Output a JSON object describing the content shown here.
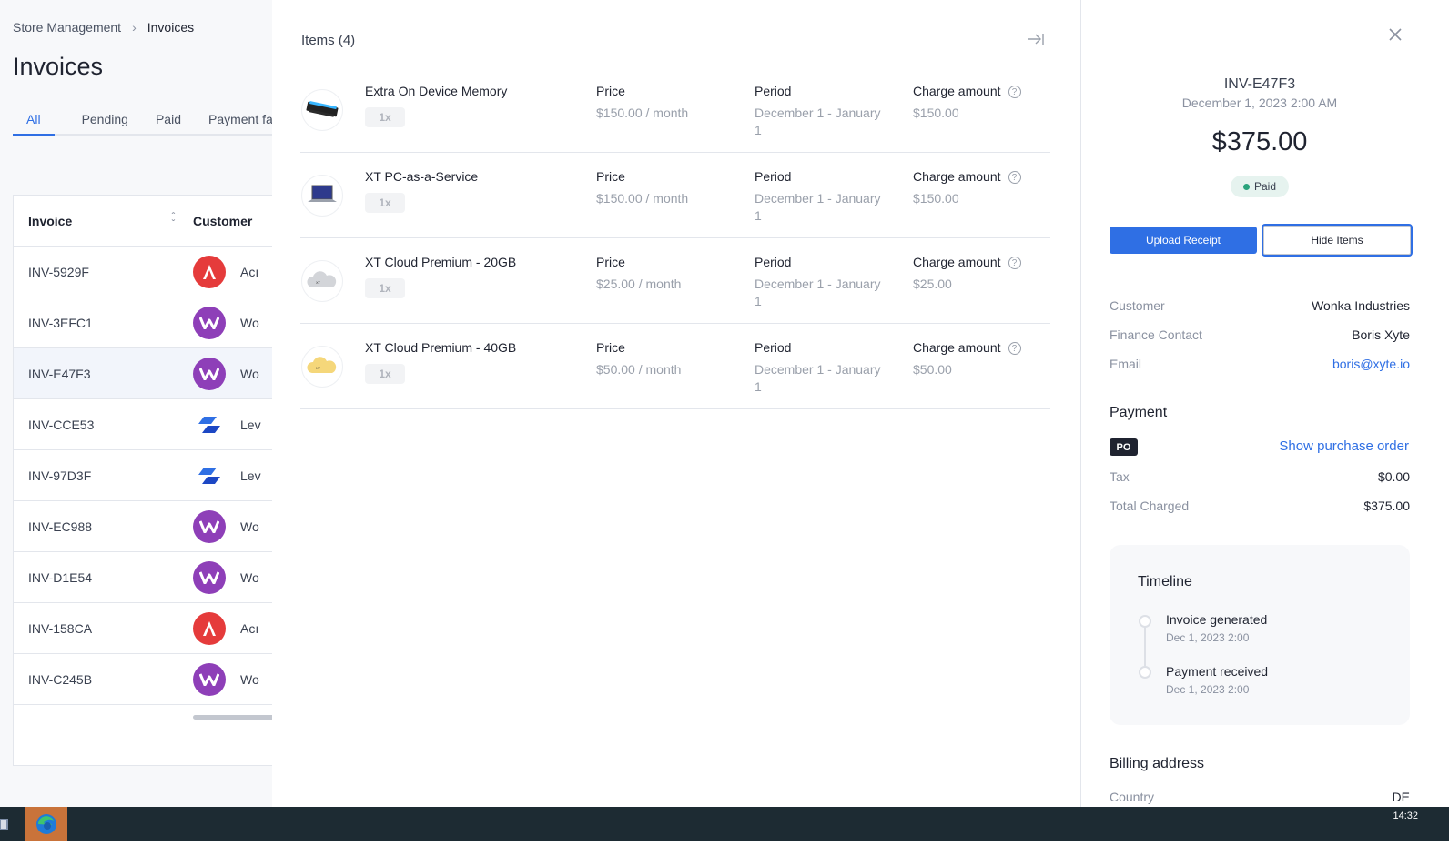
{
  "breadcrumb": {
    "parent": "Store Management",
    "current": "Invoices"
  },
  "page": {
    "title": "Invoices"
  },
  "tabs": [
    "All",
    "Pending",
    "Paid",
    "Payment fail"
  ],
  "table": {
    "headers": {
      "invoice": "Invoice",
      "customer": "Customer"
    },
    "rows": [
      {
        "invoice": "INV-5929F",
        "customer": "Acı",
        "avatar": "acme"
      },
      {
        "invoice": "INV-3EFC1",
        "customer": "Wo",
        "avatar": "wonka"
      },
      {
        "invoice": "INV-E47F3",
        "customer": "Wo",
        "avatar": "wonka"
      },
      {
        "invoice": "INV-CCE53",
        "customer": "Lev",
        "avatar": "lev"
      },
      {
        "invoice": "INV-97D3F",
        "customer": "Lev",
        "avatar": "lev"
      },
      {
        "invoice": "INV-EC988",
        "customer": "Wo",
        "avatar": "wonka"
      },
      {
        "invoice": "INV-D1E54",
        "customer": "Wo",
        "avatar": "wonka"
      },
      {
        "invoice": "INV-158CA",
        "customer": "Acı",
        "avatar": "acme"
      },
      {
        "invoice": "INV-C245B",
        "customer": "Wo",
        "avatar": "wonka"
      }
    ]
  },
  "items": {
    "title": "Items (4)",
    "labels": {
      "price": "Price",
      "period": "Period",
      "charge": "Charge amount"
    },
    "list": [
      {
        "name": "Extra On Device Memory",
        "qty": "1x",
        "price": "$150.00 / month",
        "period": "December 1 - January 1",
        "charge": "$150.00",
        "thumb": "memory"
      },
      {
        "name": "XT PC-as-a-Service",
        "qty": "1x",
        "price": "$150.00 / month",
        "period": "December 1 - January 1",
        "charge": "$150.00",
        "thumb": "laptop"
      },
      {
        "name": "XT Cloud Premium - 20GB",
        "qty": "1x",
        "price": "$25.00 / month",
        "period": "December 1 - January 1",
        "charge": "$25.00",
        "thumb": "cloud-grey"
      },
      {
        "name": "XT Cloud Premium - 40GB",
        "qty": "1x",
        "price": "$50.00 / month",
        "period": "December 1 - January 1",
        "charge": "$50.00",
        "thumb": "cloud-yellow"
      }
    ]
  },
  "detail": {
    "invoice_id": "INV-E47F3",
    "date": "December 1, 2023 2:00 AM",
    "amount": "$375.00",
    "status": "Paid",
    "upload_label": "Upload Receipt",
    "hide_items_label": "Hide Items",
    "customer": {
      "label": "Customer",
      "value": "Wonka Industries"
    },
    "finance_contact": {
      "label": "Finance Contact",
      "value": "Boris Xyte"
    },
    "email": {
      "label": "Email",
      "value": "boris@xyte.io"
    },
    "payment": {
      "title": "Payment",
      "badge": "PO",
      "show_po": "Show purchase order",
      "tax": {
        "label": "Tax",
        "value": "$0.00"
      },
      "total": {
        "label": "Total Charged",
        "value": "$375.00"
      }
    },
    "timeline": {
      "title": "Timeline",
      "events": [
        {
          "label": "Invoice generated",
          "time": "Dec 1, 2023 2:00"
        },
        {
          "label": "Payment received",
          "time": "Dec 1, 2023 2:00"
        }
      ]
    },
    "billing": {
      "title": "Billing address",
      "country": {
        "label": "Country",
        "value": "DE"
      }
    }
  },
  "taskbar": {
    "clock": "14:32"
  },
  "colors": {
    "accent": "#2f6fe4",
    "paid": "#2aa37c",
    "acme": "#e53b3b",
    "wonka": "#8e3fb8"
  }
}
